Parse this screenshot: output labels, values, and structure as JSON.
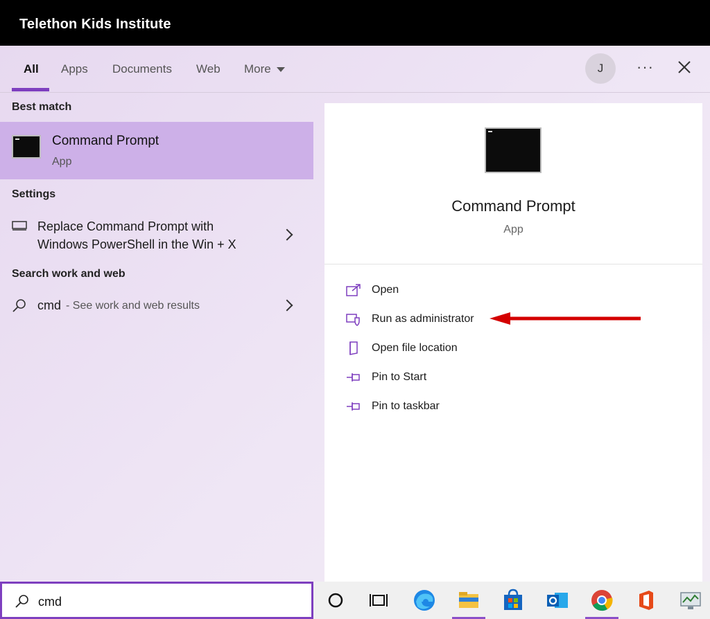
{
  "window": {
    "org_title": "Telethon Kids Institute"
  },
  "tabs": [
    {
      "label": "All",
      "active": true
    },
    {
      "label": "Apps"
    },
    {
      "label": "Documents"
    },
    {
      "label": "Web"
    },
    {
      "label": "More"
    }
  ],
  "header": {
    "avatar_initial": "J",
    "more_glyph": "···"
  },
  "results": {
    "best_match_heading": "Best match",
    "best_match": {
      "title": "Command Prompt",
      "subtitle": "App"
    },
    "settings_heading": "Settings",
    "setting_item": {
      "line1": "Replace Command Prompt with",
      "line2": "Windows PowerShell in the Win + X"
    },
    "web_heading": "Search work and web",
    "web_item": {
      "query": "cmd",
      "hint": "- See work and web results"
    }
  },
  "detail": {
    "title": "Command Prompt",
    "subtitle": "App",
    "actions": [
      {
        "label": "Open",
        "icon": "open-icon"
      },
      {
        "label": "Run as administrator",
        "icon": "shield-icon"
      },
      {
        "label": "Open file location",
        "icon": "file-location-icon"
      },
      {
        "label": "Pin to Start",
        "icon": "pin-icon"
      },
      {
        "label": "Pin to taskbar",
        "icon": "pin-icon"
      }
    ]
  },
  "search": {
    "value": "cmd"
  },
  "taskbar": {
    "icons": [
      "cortana-icon",
      "task-view-icon",
      "edge-icon",
      "file-explorer-icon",
      "store-icon",
      "outlook-icon",
      "chrome-icon",
      "office-icon",
      "performance-monitor-icon"
    ]
  },
  "colors": {
    "accent": "#7e3fbf",
    "highlight": "#cdb0e8",
    "annotation": "#d40000"
  }
}
